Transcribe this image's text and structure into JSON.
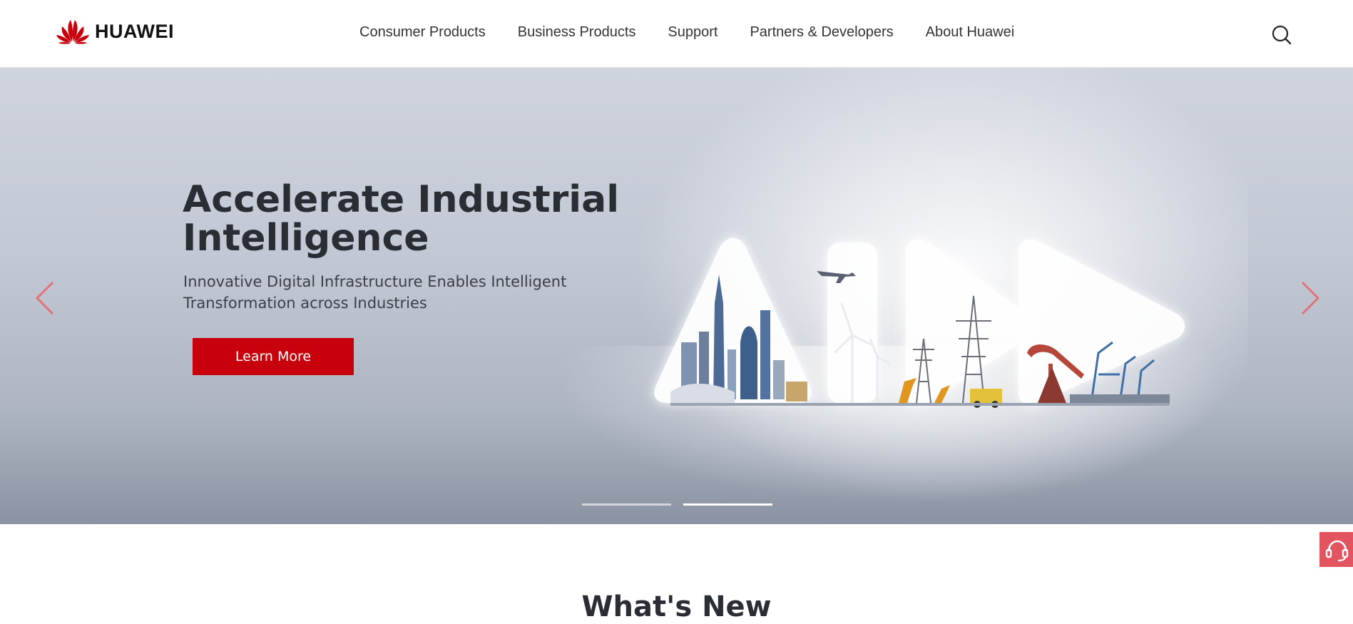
{
  "brand": {
    "logo_text": "HUAWEI",
    "logo_color": "#c7000b"
  },
  "nav": {
    "items": [
      {
        "label": "Consumer Products"
      },
      {
        "label": "Business Products"
      },
      {
        "label": "Support"
      },
      {
        "label": "Partners & Developers"
      },
      {
        "label": "About Huawei"
      }
    ],
    "search_icon": "search-icon"
  },
  "hero": {
    "title": "Accelerate Industrial Intelligence",
    "subtitle": "Innovative Digital Infrastructure Enables Intelligent Transformation across Industries",
    "cta_label": "Learn More",
    "cta_color": "#c7000b",
    "arrow_color": "#e0737a",
    "slides_total": 2,
    "active_slide": 2
  },
  "support": {
    "icon": "headset-icon",
    "color": "#e2545f"
  },
  "section": {
    "title": "What's New"
  }
}
